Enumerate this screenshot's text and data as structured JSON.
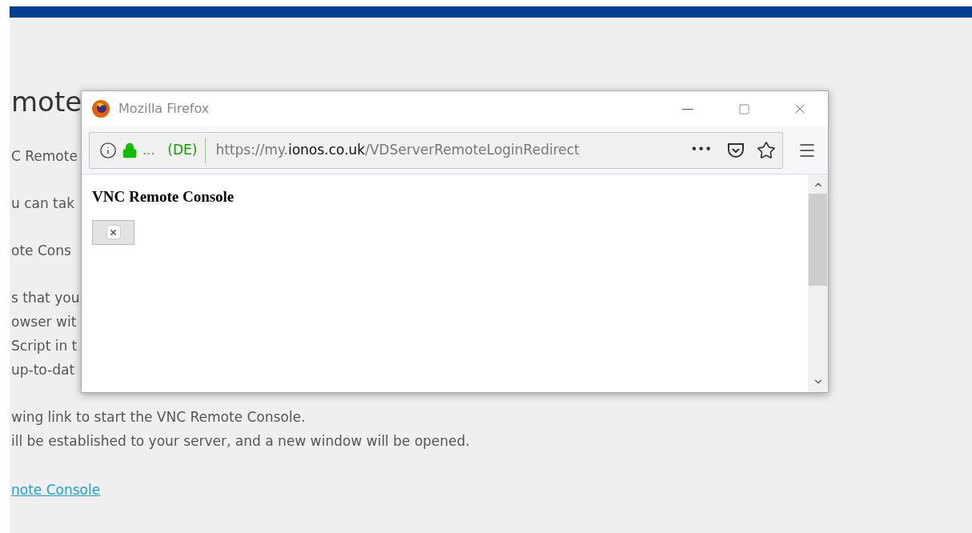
{
  "page": {
    "heading": "mote",
    "paragraphs": [
      [
        "C Remote"
      ],
      [
        "u can tak"
      ],
      [
        "ote Cons"
      ],
      [
        "s that you",
        "owser wit",
        "Script in t",
        "up-to-dat"
      ],
      [
        "wing link to start the VNC Remote Console.",
        "ill be established to your server, and a new window will be opened."
      ]
    ],
    "link": "note Console"
  },
  "window": {
    "title": "Mozilla Firefox",
    "address_bar": {
      "ellipsis": "...",
      "owner": "(DE)",
      "url_prefix": "https://my.",
      "url_domain": "ionos.co.uk",
      "url_path": "/VDServerRemoteLoginRedirect",
      "more": "•••"
    },
    "content": {
      "heading": "VNC Remote Console"
    }
  }
}
